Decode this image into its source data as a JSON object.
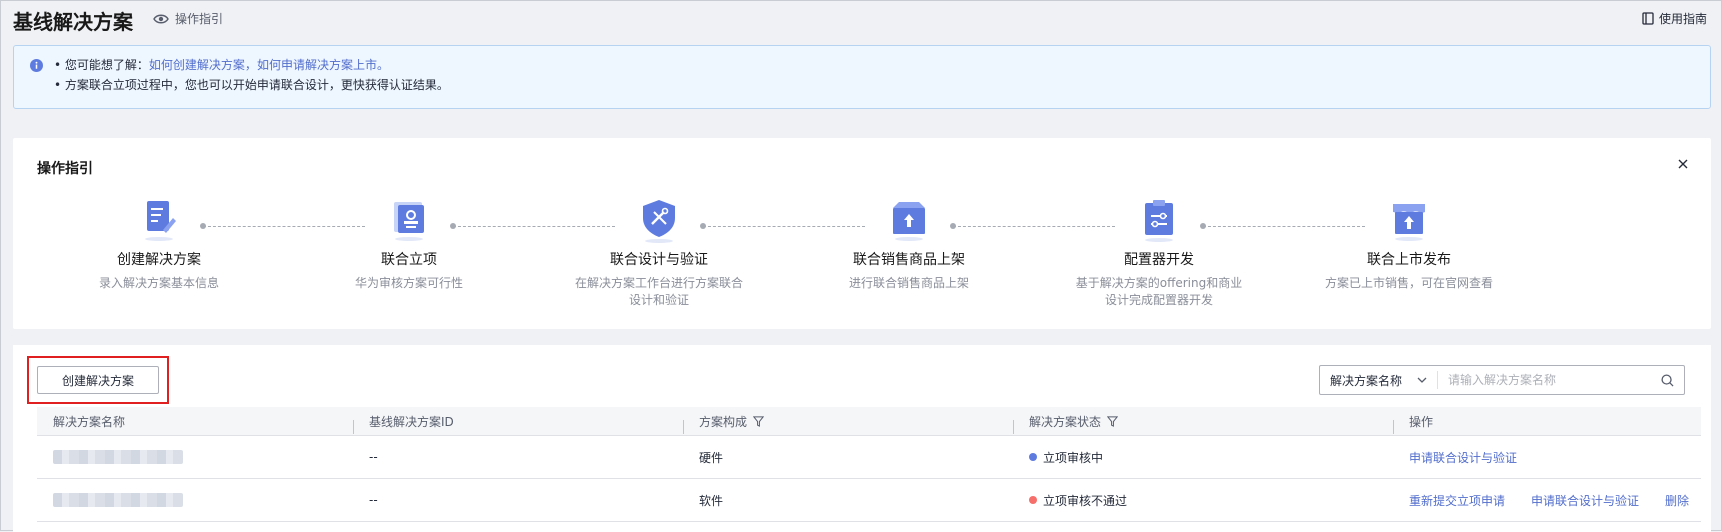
{
  "header": {
    "title": "基线解决方案",
    "guide_link": "操作指引",
    "help_link": "使用指南"
  },
  "notice": {
    "line1_prefix": "• 您可能想了解：",
    "line1_link1": "如何创建解决方案",
    "line1_sep": "，",
    "line1_link2": "如何申请解决方案上市",
    "line1_suffix": "。",
    "line2": "• 方案联合立项过程中，您也可以开始申请联合设计，更快获得认证结果。"
  },
  "guide": {
    "title": "操作指引",
    "steps": [
      {
        "title": "创建解决方案",
        "desc": "录入解决方案基本信息",
        "icon": "document-edit-icon"
      },
      {
        "title": "联合立项",
        "desc": "华为审核方案可行性",
        "icon": "stamp-icon"
      },
      {
        "title": "联合设计与验证",
        "desc": "在解决方案工作台进行方案联合\n设计和验证",
        "icon": "shield-tools-icon"
      },
      {
        "title": "联合销售商品上架",
        "desc": "进行联合销售商品上架",
        "icon": "box-upload-icon"
      },
      {
        "title": "配置器开发",
        "desc": "基于解决方案的offering和商业\n设计完成配置器开发",
        "icon": "clipboard-config-icon"
      },
      {
        "title": "联合上市发布",
        "desc": "方案已上市销售，可在官网查看",
        "icon": "store-publish-icon"
      }
    ]
  },
  "list": {
    "create_button": "创建解决方案",
    "search_field": "解决方案名称",
    "search_placeholder": "请输入解决方案名称",
    "columns": [
      "解决方案名称",
      "基线解决方案ID",
      "方案构成",
      "解决方案状态",
      "操作"
    ],
    "rows": [
      {
        "id": "--",
        "composition": "硬件",
        "status": "立项审核中",
        "status_color": "#5e7ce0",
        "actions": [
          "申请联合设计与验证"
        ]
      },
      {
        "id": "--",
        "composition": "软件",
        "status": "立项审核不通过",
        "status_color": "#f66f6a",
        "actions": [
          "重新提交立项申请",
          "申请联合设计与验证",
          "删除"
        ]
      }
    ]
  },
  "colors": {
    "accent": "#526ecc",
    "icon_blue": "#5e7ce0",
    "highlight": "#e02020"
  }
}
